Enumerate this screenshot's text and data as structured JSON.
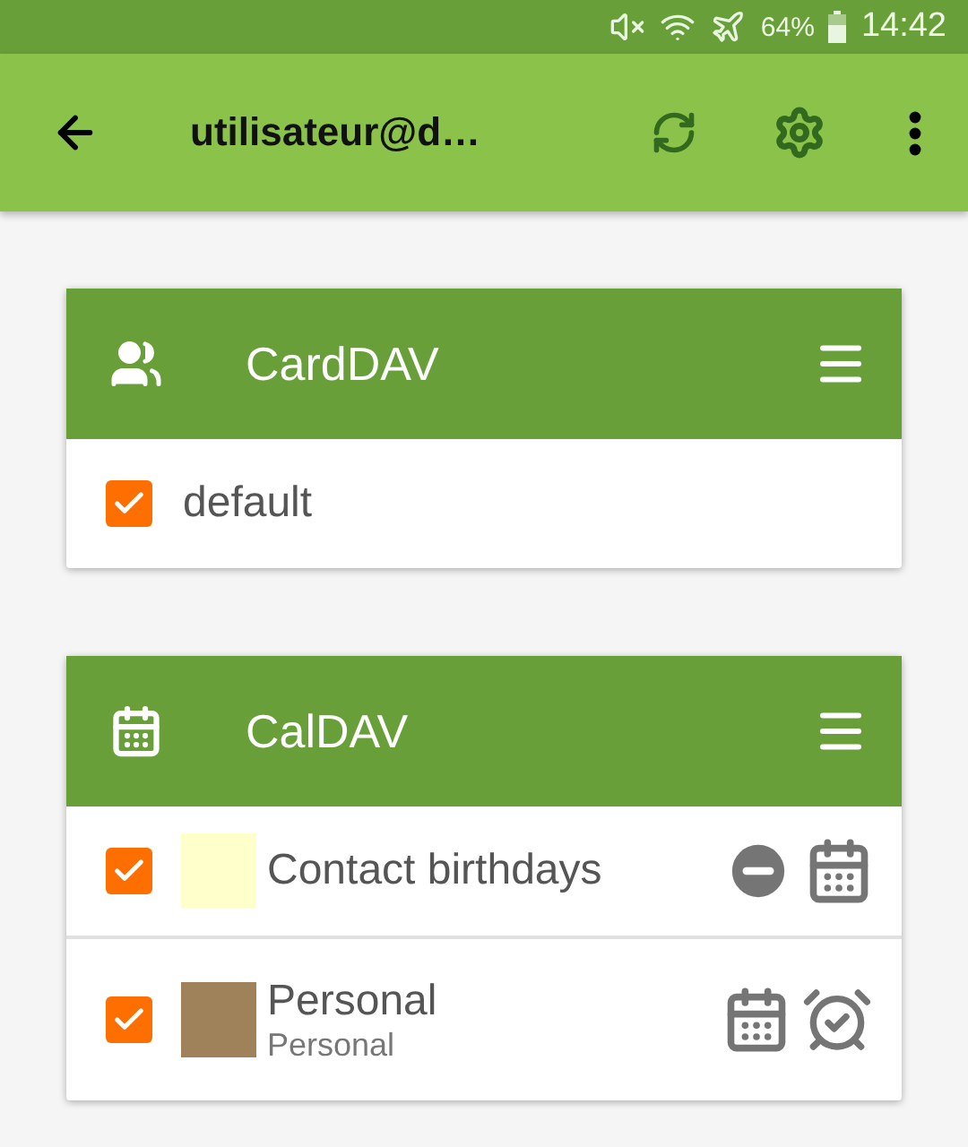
{
  "status_bar": {
    "battery": "64%",
    "time": "14:42"
  },
  "app_bar": {
    "title": "utilisateur@d…"
  },
  "cards": [
    {
      "kind": "carddav",
      "title": "CardDAV",
      "collections": [
        {
          "name": "default",
          "checked": true
        }
      ]
    },
    {
      "kind": "caldav",
      "title": "CalDAV",
      "collections": [
        {
          "name": "Contact birthdays",
          "checked": true,
          "color": "#ffffcc",
          "read_only": true,
          "events": true,
          "tasks": false
        },
        {
          "name": "Personal",
          "description": "Personal",
          "checked": true,
          "color": "#a0825a",
          "read_only": false,
          "events": true,
          "tasks": true
        }
      ]
    }
  ]
}
